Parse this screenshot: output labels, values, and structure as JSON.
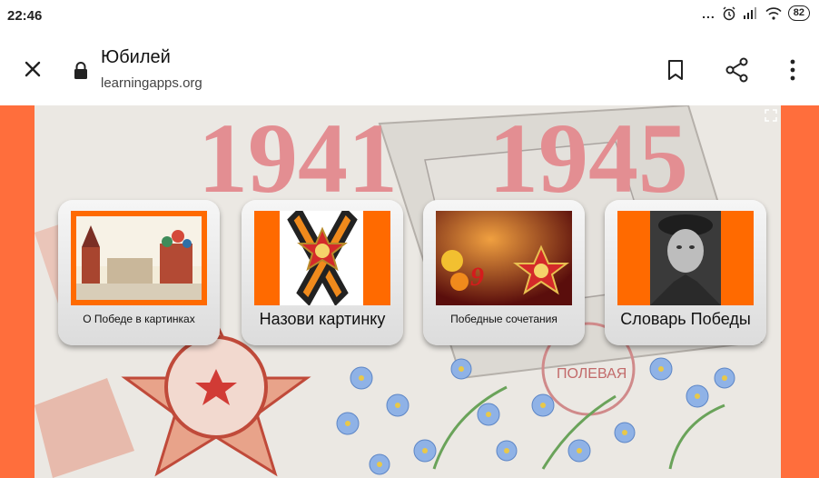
{
  "status_bar": {
    "time": "22:46",
    "dots": "...",
    "battery": "82",
    "icons": [
      "alarm-icon",
      "signal-icon",
      "wifi-icon",
      "battery-icon"
    ]
  },
  "browser": {
    "title": "Юбилей",
    "url": "learningapps.org",
    "icons": [
      "close-icon",
      "lock-icon",
      "bookmark-icon",
      "share-icon",
      "more-vert-icon"
    ]
  },
  "tiles": [
    {
      "label": "О Победе в картинках",
      "picture": "Moscow Kremlin and Red Square"
    },
    {
      "label": "Назови картинку",
      "picture": "St. George ribbon with Order of the Patriotic War"
    },
    {
      "label": "Победные сочетания",
      "picture": "9 Мая greeting card"
    },
    {
      "label": "Словарь Победы",
      "picture": "black-and-white portrait of a soldier"
    }
  ],
  "background": {
    "years": [
      "1941",
      "1945"
    ],
    "stamp_text": "ПОЛЕВАЯ",
    "colors": {
      "accent": "#ff6e3c",
      "tile_orange": "#ff6a00",
      "paper": "#ece9e4"
    }
  }
}
